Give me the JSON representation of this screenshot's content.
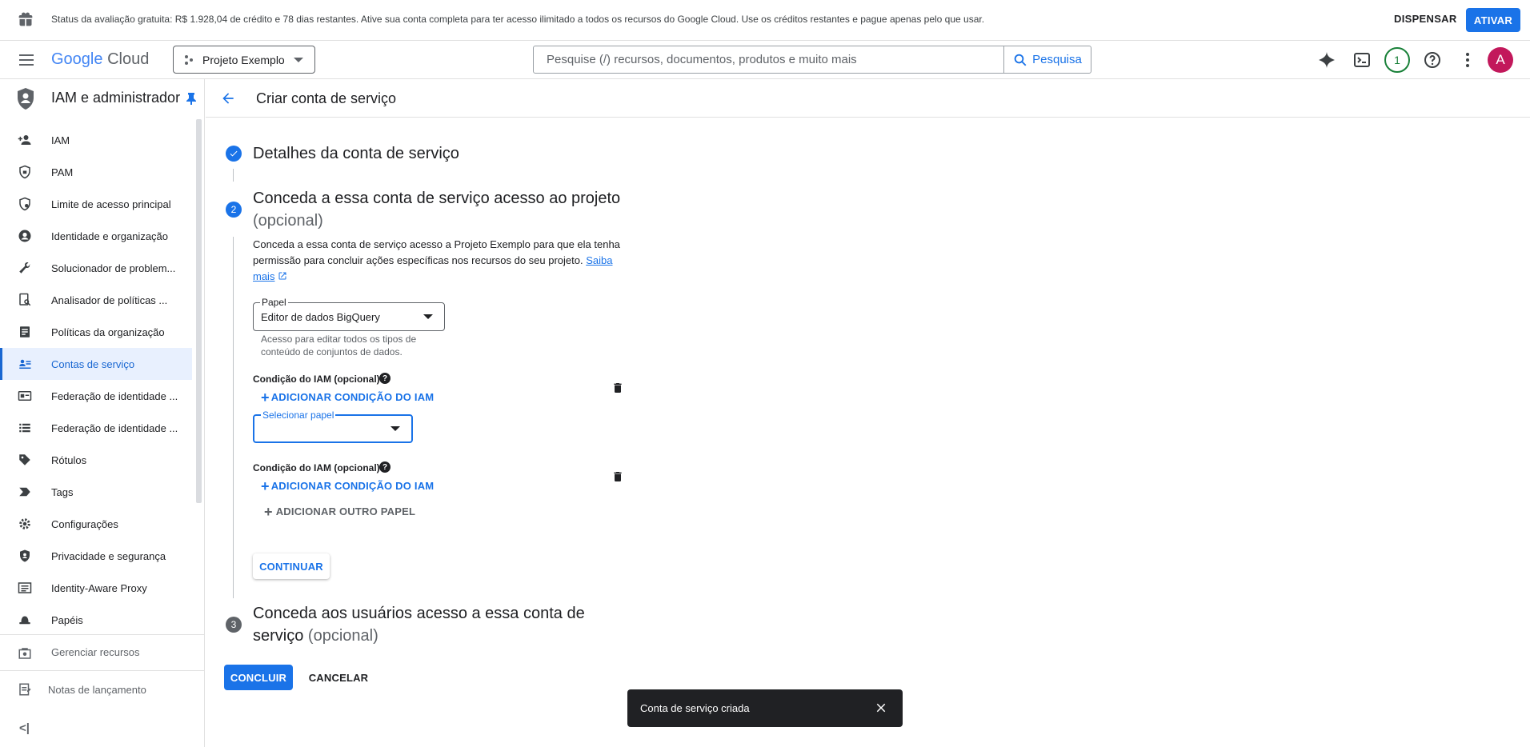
{
  "banner": {
    "message": "Status da avaliação gratuita: R$ 1.928,04 de crédito e 78 dias restantes. Ative sua conta completa para ter acesso ilimitado a todos os recursos do Google Cloud. Use os créditos restantes e pague apenas pelo que usar.",
    "dismiss_label": "DISPENSAR",
    "activate_label": "ATIVAR",
    "icon": "gift-icon"
  },
  "topnav": {
    "logo_google": "Google",
    "logo_cloud": "Cloud",
    "project": "Projeto Exemplo",
    "search_placeholder": "Pesquise (/) recursos, documentos, produtos e muito mais",
    "search_button": "Pesquisa",
    "notifications_count": "1",
    "avatar_letter": "A"
  },
  "sidebar": {
    "title": "IAM e administrador",
    "items": [
      {
        "label": "IAM",
        "icon": "person-add-icon"
      },
      {
        "label": "PAM",
        "icon": "shield-lock-icon"
      },
      {
        "label": "Limite de acesso principal",
        "icon": "shield-boundary-icon"
      },
      {
        "label": "Identidade e organização",
        "icon": "account-circle-icon"
      },
      {
        "label": "Solucionador de problem...",
        "icon": "wrench-icon"
      },
      {
        "label": "Analisador de políticas ...",
        "icon": "policy-analyzer-icon"
      },
      {
        "label": "Políticas da organização",
        "icon": "document-icon"
      },
      {
        "label": "Contas de serviço",
        "icon": "service-account-icon"
      },
      {
        "label": "Federação de identidade ...",
        "icon": "id-card-icon"
      },
      {
        "label": "Federação de identidade ...",
        "icon": "list-icon"
      },
      {
        "label": "Rótulos",
        "icon": "label-icon"
      },
      {
        "label": "Tags",
        "icon": "tag-icon"
      },
      {
        "label": "Configurações",
        "icon": "gear-icon"
      },
      {
        "label": "Privacidade e segurança",
        "icon": "privacy-shield-icon"
      },
      {
        "label": "Identity-Aware Proxy",
        "icon": "proxy-icon"
      },
      {
        "label": "Papéis",
        "icon": "hat-icon"
      }
    ],
    "manage_resources": "Gerenciar recursos",
    "release_notes": "Notas de lançamento",
    "collapse": "<|"
  },
  "main": {
    "page_title": "Criar conta de serviço",
    "step1": {
      "title": "Detalhes da conta de serviço"
    },
    "step2": {
      "number": "2",
      "title": "Conceda a essa conta de serviço acesso ao projeto",
      "optional": "(opcional)",
      "description": "Conceda a essa conta de serviço acesso a Projeto Exemplo para que ela tenha permissão para concluir ações específicas nos recursos do seu projeto.",
      "learn_more": "Saiba mais",
      "role1": {
        "label": "Papel",
        "value": "Editor de dados BigQuery",
        "hint": "Acesso para editar todos os tipos de conteúdo de conjuntos de dados."
      },
      "condition_label": "Condição do IAM (opcional)",
      "add_condition": "ADICIONAR CONDIÇÃO DO IAM",
      "role2": {
        "label": "Selecionar papel",
        "value": ""
      },
      "add_another_role": "ADICIONAR OUTRO PAPEL",
      "continue": "CONTINUAR"
    },
    "step3": {
      "number": "3",
      "title": "Conceda aos usuários acesso a essa conta de serviço",
      "optional": "(opcional)"
    },
    "done": "CONCLUIR",
    "cancel": "CANCELAR"
  },
  "snackbar": {
    "message": "Conta de serviço criada"
  },
  "colors": {
    "accent": "#1a73e8",
    "active_bg": "#e8f0fe",
    "avatar": "#c2185b",
    "notif": "#188038"
  }
}
